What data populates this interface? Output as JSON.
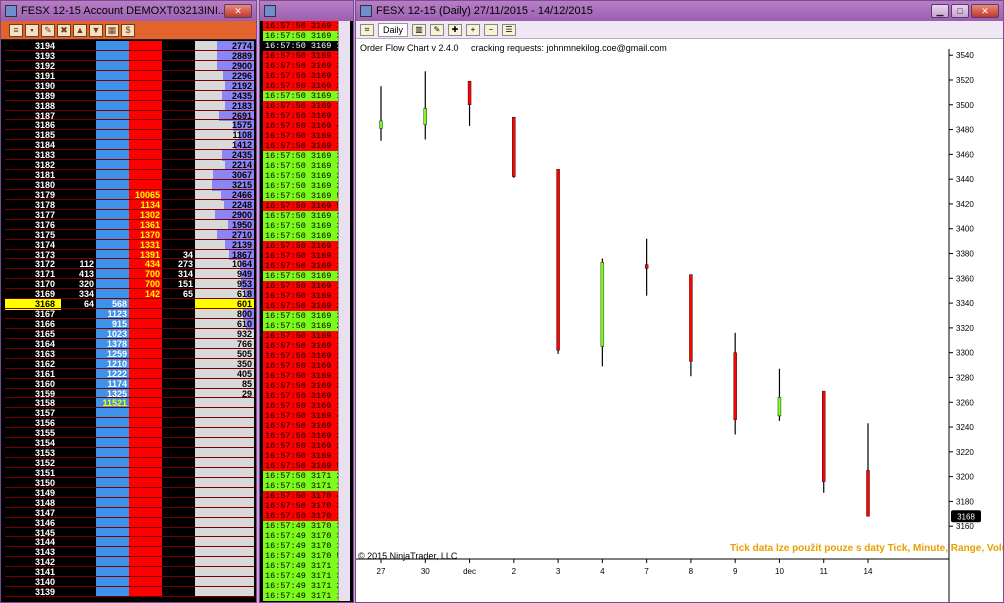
{
  "dom_window": {
    "title": "FESX 12-15  Account DEMOXT03213INI...",
    "toolbar_icons": [
      "menu-icon",
      "save-icon",
      "edit-icon",
      "cancel-all-icon",
      "buy-icon",
      "sell-icon",
      "grid-icon",
      "dollar-icon"
    ],
    "rows": [
      {
        "price": "3194",
        "bid": "",
        "bsz": "",
        "asz": "",
        "ask": "",
        "vol": "2774",
        "bar": 0.62
      },
      {
        "price": "3193",
        "bid": "",
        "bsz": "",
        "asz": "",
        "ask": "",
        "vol": "2889",
        "bar": 0.62
      },
      {
        "price": "3192",
        "bid": "",
        "bsz": "",
        "asz": "",
        "ask": "",
        "vol": "2900",
        "bar": 0.62
      },
      {
        "price": "3191",
        "bid": "",
        "bsz": "",
        "asz": "",
        "ask": "",
        "vol": "2296",
        "bar": 0.52
      },
      {
        "price": "3190",
        "bid": "",
        "bsz": "",
        "asz": "",
        "ask": "",
        "vol": "2192",
        "bar": 0.5
      },
      {
        "price": "3189",
        "bid": "",
        "bsz": "",
        "asz": "",
        "ask": "",
        "vol": "2435",
        "bar": 0.55
      },
      {
        "price": "3188",
        "bid": "",
        "bsz": "",
        "asz": "",
        "ask": "",
        "vol": "2183",
        "bar": 0.5
      },
      {
        "price": "3187",
        "bid": "",
        "bsz": "",
        "asz": "",
        "ask": "",
        "vol": "2691",
        "bar": 0.6
      },
      {
        "price": "3186",
        "bid": "",
        "bsz": "",
        "asz": "",
        "ask": "",
        "vol": "1575",
        "bar": 0.36
      },
      {
        "price": "3185",
        "bid": "",
        "bsz": "",
        "asz": "",
        "ask": "",
        "vol": "1108",
        "bar": 0.26
      },
      {
        "price": "3184",
        "bid": "",
        "bsz": "",
        "asz": "",
        "ask": "",
        "vol": "1412",
        "bar": 0.32
      },
      {
        "price": "3183",
        "bid": "",
        "bsz": "",
        "asz": "",
        "ask": "",
        "vol": "2435",
        "bar": 0.55
      },
      {
        "price": "3182",
        "bid": "",
        "bsz": "",
        "asz": "",
        "ask": "",
        "vol": "2214",
        "bar": 0.5
      },
      {
        "price": "3181",
        "bid": "",
        "bsz": "",
        "asz": "",
        "ask": "",
        "vol": "3067",
        "bar": 0.7
      },
      {
        "price": "3180",
        "bid": "",
        "bsz": "",
        "asz": "",
        "ask": "",
        "vol": "3215",
        "bar": 0.72
      },
      {
        "price": "3179",
        "bid": "",
        "bsz": "",
        "asz": "10065",
        "ask": "",
        "vol": "2466",
        "bar": 0.56
      },
      {
        "price": "3178",
        "bid": "",
        "bsz": "",
        "asz": "1134",
        "ask": "",
        "vol": "2248",
        "bar": 0.51
      },
      {
        "price": "3177",
        "bid": "",
        "bsz": "",
        "asz": "1302",
        "ask": "",
        "vol": "2900",
        "bar": 0.66
      },
      {
        "price": "3176",
        "bid": "",
        "bsz": "",
        "asz": "1361",
        "ask": "",
        "vol": "1950",
        "bar": 0.44
      },
      {
        "price": "3175",
        "bid": "",
        "bsz": "",
        "asz": "1370",
        "ask": "",
        "vol": "2710",
        "bar": 0.62
      },
      {
        "price": "3174",
        "bid": "",
        "bsz": "",
        "asz": "1331",
        "ask": "",
        "vol": "2139",
        "bar": 0.49
      },
      {
        "price": "3173",
        "bid": "",
        "bsz": "",
        "asz": "1391",
        "ask": "34",
        "vol": "1867",
        "bar": 0.42
      },
      {
        "price": "3172",
        "bid": "112",
        "bsz": "",
        "asz": "434",
        "ask": "273",
        "vol": "1064",
        "bar": 0.24
      },
      {
        "price": "3171",
        "bid": "413",
        "bsz": "",
        "asz": "700",
        "ask": "314",
        "vol": "949",
        "bar": 0.22
      },
      {
        "price": "3170",
        "bid": "320",
        "bsz": "",
        "asz": "700",
        "ask": "151",
        "vol": "953",
        "bar": 0.22
      },
      {
        "price": "3169",
        "bid": "334",
        "bsz": "",
        "asz": "142",
        "ask": "65",
        "vol": "618",
        "bar": 0.14
      },
      {
        "price": "3168",
        "bid": "64",
        "bsz": "568",
        "asz": "",
        "ask": "",
        "vol": "601",
        "bar": 0.14,
        "current": true
      },
      {
        "price": "3167",
        "bid": "",
        "bsz": "1123",
        "asz": "",
        "ask": "",
        "vol": "800",
        "bar": 0.18
      },
      {
        "price": "3166",
        "bid": "",
        "bsz": "915",
        "asz": "",
        "ask": "",
        "vol": "610",
        "bar": 0.14
      },
      {
        "price": "3165",
        "bid": "",
        "bsz": "1023",
        "asz": "",
        "ask": "",
        "vol": "932",
        "bar": 0
      },
      {
        "price": "3164",
        "bid": "",
        "bsz": "1378",
        "asz": "",
        "ask": "",
        "vol": "766",
        "bar": 0
      },
      {
        "price": "3163",
        "bid": "",
        "bsz": "1259",
        "asz": "",
        "ask": "",
        "vol": "505",
        "bar": 0
      },
      {
        "price": "3162",
        "bid": "",
        "bsz": "1210",
        "asz": "",
        "ask": "",
        "vol": "350",
        "bar": 0
      },
      {
        "price": "3161",
        "bid": "",
        "bsz": "1222",
        "asz": "",
        "ask": "",
        "vol": "405",
        "bar": 0
      },
      {
        "price": "3160",
        "bid": "",
        "bsz": "1174",
        "asz": "",
        "ask": "",
        "vol": "85",
        "bar": 0
      },
      {
        "price": "3159",
        "bid": "",
        "bsz": "1325",
        "asz": "",
        "ask": "",
        "vol": "29",
        "bar": 0
      },
      {
        "price": "3158",
        "bid": "",
        "bsz": "11521",
        "asz": "",
        "ask": "",
        "vol": "",
        "bar": 0,
        "yellow_bid": true
      },
      {
        "price": "3157",
        "bid": "",
        "bsz": "",
        "asz": "",
        "ask": "",
        "vol": "",
        "bar": 0
      },
      {
        "price": "3156",
        "bid": "",
        "bsz": "",
        "asz": "",
        "ask": "",
        "vol": "",
        "bar": 0
      },
      {
        "price": "3155",
        "bid": "",
        "bsz": "",
        "asz": "",
        "ask": "",
        "vol": "",
        "bar": 0
      },
      {
        "price": "3154",
        "bid": "",
        "bsz": "",
        "asz": "",
        "ask": "",
        "vol": "",
        "bar": 0
      },
      {
        "price": "3153",
        "bid": "",
        "bsz": "",
        "asz": "",
        "ask": "",
        "vol": "",
        "bar": 0
      },
      {
        "price": "3152",
        "bid": "",
        "bsz": "",
        "asz": "",
        "ask": "",
        "vol": "",
        "bar": 0
      },
      {
        "price": "3151",
        "bid": "",
        "bsz": "",
        "asz": "",
        "ask": "",
        "vol": "",
        "bar": 0
      },
      {
        "price": "3150",
        "bid": "",
        "bsz": "",
        "asz": "",
        "ask": "",
        "vol": "",
        "bar": 0
      },
      {
        "price": "3149",
        "bid": "",
        "bsz": "",
        "asz": "",
        "ask": "",
        "vol": "",
        "bar": 0
      },
      {
        "price": "3148",
        "bid": "",
        "bsz": "",
        "asz": "",
        "ask": "",
        "vol": "",
        "bar": 0
      },
      {
        "price": "3147",
        "bid": "",
        "bsz": "",
        "asz": "",
        "ask": "",
        "vol": "",
        "bar": 0
      },
      {
        "price": "3146",
        "bid": "",
        "bsz": "",
        "asz": "",
        "ask": "",
        "vol": "",
        "bar": 0
      },
      {
        "price": "3145",
        "bid": "",
        "bsz": "",
        "asz": "",
        "ask": "",
        "vol": "",
        "bar": 0
      },
      {
        "price": "3144",
        "bid": "",
        "bsz": "",
        "asz": "",
        "ask": "",
        "vol": "",
        "bar": 0
      },
      {
        "price": "3143",
        "bid": "",
        "bsz": "",
        "asz": "",
        "ask": "",
        "vol": "",
        "bar": 0
      },
      {
        "price": "3142",
        "bid": "",
        "bsz": "",
        "asz": "",
        "ask": "",
        "vol": "",
        "bar": 0
      },
      {
        "price": "3141",
        "bid": "",
        "bsz": "",
        "asz": "",
        "ask": "",
        "vol": "",
        "bar": 0
      },
      {
        "price": "3140",
        "bid": "",
        "bsz": "",
        "asz": "",
        "ask": "",
        "vol": "",
        "bar": 0
      },
      {
        "price": "3139",
        "bid": "",
        "bsz": "",
        "asz": "",
        "ask": "",
        "vol": "",
        "bar": 0
      }
    ]
  },
  "ts_window": {
    "rows": [
      {
        "t": "16:57:50",
        "p": "3169",
        "q": "1",
        "c": "r"
      },
      {
        "t": "16:57:50",
        "p": "3169",
        "q": "3",
        "c": "g"
      },
      {
        "t": "16:57:50",
        "p": "3169",
        "q": "1",
        "c": "k"
      },
      {
        "t": "16:57:50",
        "p": "3169",
        "q": "1",
        "c": "r"
      },
      {
        "t": "16:57:50",
        "p": "3169",
        "q": "3",
        "c": "r"
      },
      {
        "t": "16:57:50",
        "p": "3169",
        "q": "2",
        "c": "r"
      },
      {
        "t": "16:57:50",
        "p": "3169",
        "q": "2",
        "c": "r"
      },
      {
        "t": "16:57:50",
        "p": "3169",
        "q": "11",
        "c": "g"
      },
      {
        "t": "16:57:50",
        "p": "3169",
        "q": "1",
        "c": "r"
      },
      {
        "t": "16:57:50",
        "p": "3169",
        "q": "1",
        "c": "r"
      },
      {
        "t": "16:57:50",
        "p": "3169",
        "q": "4",
        "c": "r"
      },
      {
        "t": "16:57:50",
        "p": "3169",
        "q": "10",
        "c": "r"
      },
      {
        "t": "16:57:50",
        "p": "3169",
        "q": "3",
        "c": "r"
      },
      {
        "t": "16:57:50",
        "p": "3169",
        "q": "3",
        "c": "g"
      },
      {
        "t": "16:57:50",
        "p": "3169",
        "q": "3",
        "c": "g"
      },
      {
        "t": "16:57:50",
        "p": "3169",
        "q": "2",
        "c": "g"
      },
      {
        "t": "16:57:50",
        "p": "3169",
        "q": "2",
        "c": "g"
      },
      {
        "t": "16:57:50",
        "p": "3169",
        "q": "5",
        "c": "g"
      },
      {
        "t": "16:57:50",
        "p": "3169",
        "q": "5",
        "c": "r"
      },
      {
        "t": "16:57:50",
        "p": "3169",
        "q": "3",
        "c": "g"
      },
      {
        "t": "16:57:50",
        "p": "3169",
        "q": "3",
        "c": "g"
      },
      {
        "t": "16:57:50",
        "p": "3169",
        "q": "2",
        "c": "g"
      },
      {
        "t": "16:57:50",
        "p": "3169",
        "q": "1",
        "c": "r"
      },
      {
        "t": "16:57:50",
        "p": "3169",
        "q": "14",
        "c": "r"
      },
      {
        "t": "16:57:50",
        "p": "3169",
        "q": "1",
        "c": "r"
      },
      {
        "t": "16:57:50",
        "p": "3169",
        "q": "3",
        "c": "g"
      },
      {
        "t": "16:57:50",
        "p": "3169",
        "q": "1",
        "c": "r"
      },
      {
        "t": "16:57:50",
        "p": "3169",
        "q": "10",
        "c": "r"
      },
      {
        "t": "16:57:50",
        "p": "3169",
        "q": "2",
        "c": "r"
      },
      {
        "t": "16:57:50",
        "p": "3169",
        "q": "3",
        "c": "g"
      },
      {
        "t": "16:57:50",
        "p": "3169",
        "q": "2",
        "c": "g"
      },
      {
        "t": "16:57:50",
        "p": "3169",
        "q": "11",
        "c": "r"
      },
      {
        "t": "16:57:50",
        "p": "3169",
        "q": "1",
        "c": "r"
      },
      {
        "t": "16:57:50",
        "p": "3169",
        "q": "1",
        "c": "r"
      },
      {
        "t": "16:57:50",
        "p": "3169",
        "q": "3",
        "c": "r"
      },
      {
        "t": "16:57:50",
        "p": "3169",
        "q": "10",
        "c": "r"
      },
      {
        "t": "16:57:50",
        "p": "3169",
        "q": "2",
        "c": "r"
      },
      {
        "t": "16:57:50",
        "p": "3169",
        "q": "1",
        "c": "r"
      },
      {
        "t": "16:57:50",
        "p": "3169",
        "q": "1",
        "c": "r"
      },
      {
        "t": "16:57:50",
        "p": "3169",
        "q": "4",
        "c": "r"
      },
      {
        "t": "16:57:50",
        "p": "3169",
        "q": "1",
        "c": "r"
      },
      {
        "t": "16:57:50",
        "p": "3169",
        "q": "2",
        "c": "r"
      },
      {
        "t": "16:57:50",
        "p": "3169",
        "q": "21",
        "c": "r"
      },
      {
        "t": "16:57:50",
        "p": "3169",
        "q": "1",
        "c": "r"
      },
      {
        "t": "16:57:50",
        "p": "3169",
        "q": "5",
        "c": "r"
      },
      {
        "t": "16:57:50",
        "p": "3171",
        "q": "2",
        "c": "g"
      },
      {
        "t": "16:57:50",
        "p": "3171",
        "q": "1",
        "c": "g"
      },
      {
        "t": "16:57:50",
        "p": "3170",
        "q": "4",
        "c": "r"
      },
      {
        "t": "16:57:50",
        "p": "3170",
        "q": "2",
        "c": "r"
      },
      {
        "t": "16:57:50",
        "p": "3170",
        "q": "1",
        "c": "r"
      },
      {
        "t": "16:57:49",
        "p": "3170",
        "q": "3",
        "c": "g"
      },
      {
        "t": "16:57:49",
        "p": "3170",
        "q": "3",
        "c": "g"
      },
      {
        "t": "16:57:49",
        "p": "3170",
        "q": "1",
        "c": "g"
      },
      {
        "t": "16:57:49",
        "p": "3170",
        "q": "55",
        "c": "g"
      },
      {
        "t": "16:57:49",
        "p": "3171",
        "q": "1",
        "c": "g"
      },
      {
        "t": "16:57:49",
        "p": "3171",
        "q": "3",
        "c": "g"
      },
      {
        "t": "16:57:49",
        "p": "3171",
        "q": "29",
        "c": "g"
      },
      {
        "t": "16:57:49",
        "p": "3171",
        "q": "1",
        "c": "g"
      }
    ]
  },
  "chart_window": {
    "title": "FESX 12-15 (Daily)  27/11/2015 - 14/12/2015",
    "interval": "Daily",
    "info_left": "Order Flow Chart v 2.4.0",
    "info_right": "cracking requests: johnmnekilog.coe@gmail.com",
    "watermark": "Tick data lze použít pouze s daty Tick, Minute, Range, Volume",
    "copyright": "© 2015 NinjaTrader, LLC",
    "current_price": "3168",
    "up_color": "#7dfc1c",
    "down_color": "#ff0000"
  },
  "chart_data": {
    "type": "candlestick",
    "x_ticks": [
      "27",
      "30",
      "dec",
      "2",
      "3",
      "4",
      "7",
      "8",
      "9",
      "10",
      "11",
      "14"
    ],
    "y_ticks": [
      "3540",
      "3520",
      "3500",
      "3480",
      "3460",
      "3440",
      "3420",
      "3400",
      "3380",
      "3360",
      "3340",
      "3320",
      "3300",
      "3280",
      "3260",
      "3240",
      "3220",
      "3200",
      "3180",
      "3160"
    ],
    "candles": [
      {
        "x": "27",
        "open": 3481,
        "high": 3515,
        "low": 3471,
        "close": 3487
      },
      {
        "x": "30",
        "open": 3484,
        "high": 3527,
        "low": 3472,
        "close": 3497
      },
      {
        "x": "dec",
        "open": 3519,
        "high": 3519,
        "low": 3483,
        "close": 3500
      },
      {
        "x": "2",
        "open": 3490,
        "high": 3490,
        "low": 3441,
        "close": 3442
      },
      {
        "x": "3",
        "open": 3448,
        "high": 3448,
        "low": 3299,
        "close": 3302
      },
      {
        "x": "4",
        "open": 3305,
        "high": 3376,
        "low": 3289,
        "close": 3373
      },
      {
        "x": "7",
        "open": 3371,
        "high": 3392,
        "low": 3346,
        "close": 3368
      },
      {
        "x": "8",
        "open": 3363,
        "high": 3363,
        "low": 3281,
        "close": 3293
      },
      {
        "x": "9",
        "open": 3300,
        "high": 3316,
        "low": 3234,
        "close": 3246
      },
      {
        "x": "10",
        "open": 3249,
        "high": 3287,
        "low": 3245,
        "close": 3264
      },
      {
        "x": "11",
        "open": 3269,
        "high": 3269,
        "low": 3187,
        "close": 3196
      },
      {
        "x": "14",
        "open": 3205,
        "high": 3243,
        "low": 3168,
        "close": 3168
      }
    ],
    "ylim": [
      3140,
      3545
    ]
  }
}
